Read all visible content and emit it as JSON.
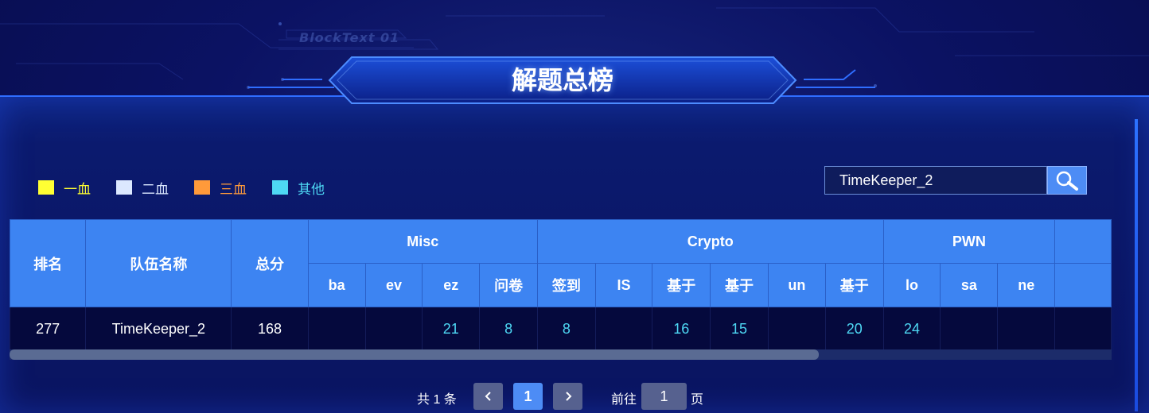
{
  "header": {
    "title": "解题总榜",
    "bg_text": "BlockText 01"
  },
  "legend": [
    {
      "label": "一血",
      "color": "#ffff33"
    },
    {
      "label": "二血",
      "color": "#dce8ff"
    },
    {
      "label": "三血",
      "color": "#ff9a3a"
    },
    {
      "label": "其他",
      "color": "#4ed8f4"
    }
  ],
  "search": {
    "value": "TimeKeeper_2",
    "placeholder": ""
  },
  "table": {
    "fixed_headers": {
      "rank": "排名",
      "team": "队伍名称",
      "total": "总分"
    },
    "groups": [
      {
        "name": "Misc",
        "columns": [
          "ba",
          "ev",
          "ez",
          "问卷"
        ]
      },
      {
        "name": "Crypto",
        "columns": [
          "签到",
          "IS",
          "基于",
          "基于",
          "un",
          "基于"
        ]
      },
      {
        "name": "PWN",
        "columns": [
          "lo",
          "sa",
          "ne"
        ]
      }
    ],
    "rows": [
      {
        "rank": "277",
        "team": "TimeKeeper_2",
        "total": "168",
        "scores": [
          "",
          "",
          "21",
          "8",
          "8",
          "",
          "16",
          "15",
          "",
          "20",
          "24",
          "",
          ""
        ]
      }
    ]
  },
  "scroll": {
    "horizontal_fraction_visible": 0.73
  },
  "pagination": {
    "total": "共 1 条",
    "current": "1",
    "goto_label": "前往",
    "goto_value": "1",
    "page_label": "页"
  }
}
